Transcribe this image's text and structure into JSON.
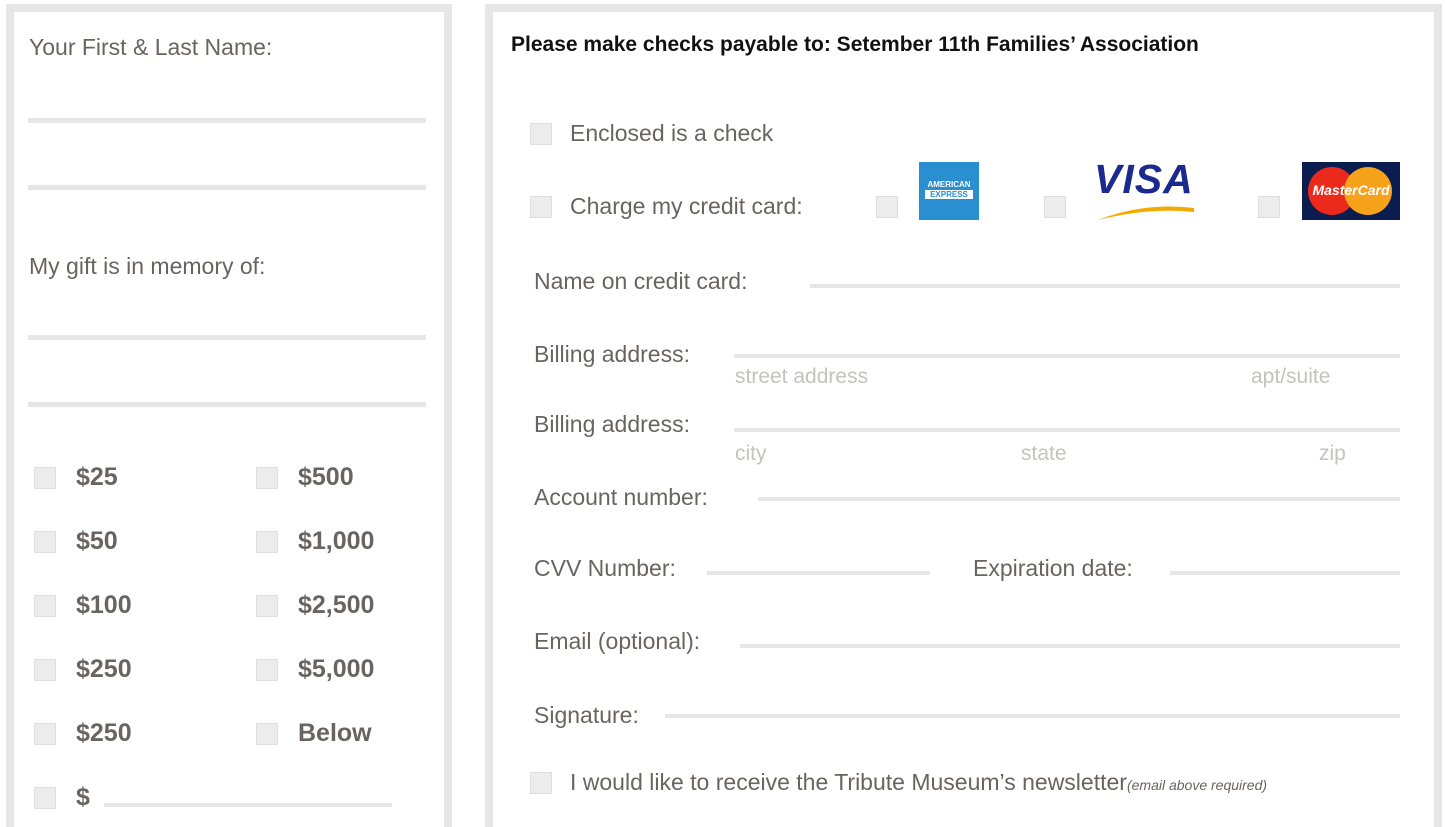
{
  "left": {
    "name_label": "Your First & Last Name:",
    "memory_label": "My gift is in memory of:",
    "amounts": {
      "a25": "$25",
      "a500": "$500",
      "a50": "$50",
      "a1000": "$1,000",
      "a100": "$100",
      "a2500": "$2,500",
      "a250": "$250",
      "a5000": "$5,000",
      "a250b": "$250",
      "below": "Below",
      "other": "$"
    }
  },
  "right": {
    "header": "Please make checks payable to:  Setember 11th Families’ Association",
    "enclosed_check": "Enclosed is a check",
    "charge_card": "Charge my credit card:",
    "cards": {
      "amex_line1": "AMERICAN",
      "amex_line2": "EXPRESS",
      "visa": "VISA",
      "mastercard": "MasterCard"
    },
    "name_on_card": "Name on credit card:",
    "billing_address_1": "Billing address:",
    "street_address": "street address",
    "apt_suite": "apt/suite",
    "billing_address_2": "Billing address:",
    "city": "city",
    "state": "state",
    "zip": "zip",
    "account_number": "Account number:",
    "cvv": "CVV Number:",
    "expiration": "Expiration date:",
    "email": "Email (optional):",
    "signature": "Signature:",
    "newsletter": "I would like to receive the Tribute Museum’s newsletter",
    "newsletter_note": "(email above required)"
  },
  "colors": {
    "panel_border": "#e6e6e6",
    "text": "#6a6461",
    "placeholder": "#c6c2bf",
    "amex_blue": "#2a8fd0",
    "visa_blue": "#1a2a8f",
    "visa_gold": "#f2a900",
    "mastercard_red": "#eb2a1c",
    "mastercard_orange": "#f7a21b",
    "mastercard_bg": "#0b1d4f"
  }
}
